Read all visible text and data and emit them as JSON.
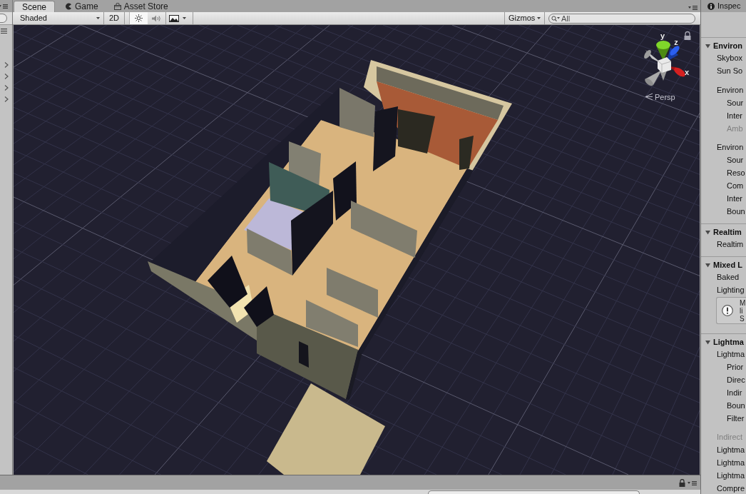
{
  "hierarchy": {
    "rows": [
      {
        "expanded": false
      },
      {
        "expanded": false
      },
      {
        "expanded": false
      },
      {
        "expanded": false
      }
    ]
  },
  "tabs": [
    {
      "kind": "scene",
      "label": "Scene",
      "selected": true
    },
    {
      "kind": "game",
      "label": "Game",
      "selected": false
    },
    {
      "kind": "store",
      "label": "Asset Store",
      "selected": false
    }
  ],
  "scene_toolbar": {
    "draw_mode": "Shaded",
    "toggles": [
      {
        "kind": "mode",
        "label": "2D",
        "on": false
      },
      {
        "kind": "lighting",
        "on": true
      },
      {
        "kind": "audio",
        "on": false
      },
      {
        "kind": "effects",
        "on": false
      }
    ],
    "gizmos": "Gizmos",
    "search": {
      "placeholder": "All"
    }
  },
  "scene_view": {
    "axes": [
      {
        "label": "y"
      },
      {
        "label": "z"
      },
      {
        "label": "x"
      }
    ],
    "projection": "Persp"
  },
  "inspector": {
    "tab": "Inspec",
    "sections": [
      {
        "title": "Environ",
        "expanded": true,
        "rows": [
          {
            "kind": "field",
            "label": "Skybox",
            "disabled": false
          },
          {
            "kind": "field",
            "label": "Sun So",
            "disabled": false
          },
          {
            "kind": "group",
            "label": "Environ",
            "disabled": false,
            "children": [
              {
                "kind": "field",
                "label": "Sour",
                "disabled": false
              },
              {
                "kind": "field",
                "label": "Inter",
                "disabled": false
              },
              {
                "kind": "field",
                "label": "Amb",
                "disabled": true
              }
            ]
          },
          {
            "kind": "group",
            "label": "Environ",
            "disabled": false,
            "children": [
              {
                "kind": "field",
                "label": "Sour",
                "disabled": false
              },
              {
                "kind": "field",
                "label": "Reso",
                "disabled": false
              },
              {
                "kind": "field",
                "label": "Com",
                "disabled": false
              },
              {
                "kind": "field",
                "label": "Inter",
                "disabled": false
              },
              {
                "kind": "field",
                "label": "Boun",
                "disabled": false
              }
            ]
          }
        ]
      },
      {
        "title": "Realtim",
        "expanded": true,
        "rows": [
          {
            "kind": "field",
            "label": "Realtim",
            "disabled": false
          }
        ]
      },
      {
        "title": "Mixed L",
        "expanded": true,
        "rows": [
          {
            "kind": "field",
            "label": "Baked",
            "disabled": false
          },
          {
            "kind": "field",
            "label": "Lighting",
            "disabled": false
          },
          {
            "kind": "help",
            "lines": [
              "M",
              "li",
              "S"
            ],
            "disabled": false
          }
        ]
      },
      {
        "title": "Lightma",
        "expanded": true,
        "rows": [
          {
            "kind": "group",
            "label": "Lightma",
            "disabled": false,
            "children": [
              {
                "kind": "field",
                "label": "Prior",
                "disabled": false
              },
              {
                "kind": "field",
                "label": "Direc",
                "disabled": false
              },
              {
                "kind": "field",
                "label": "Indir",
                "disabled": false
              },
              {
                "kind": "field",
                "label": "Boun",
                "disabled": false
              },
              {
                "kind": "field",
                "label": "Filter",
                "disabled": false
              }
            ]
          },
          {
            "kind": "field",
            "label": "Indirect",
            "disabled": true
          },
          {
            "kind": "field",
            "label": "Lightma",
            "disabled": false
          },
          {
            "kind": "field",
            "label": "Lightma",
            "disabled": false
          },
          {
            "kind": "field",
            "label": "Lightma",
            "disabled": false
          },
          {
            "kind": "field",
            "label": "Compre",
            "disabled": false
          }
        ]
      }
    ]
  }
}
